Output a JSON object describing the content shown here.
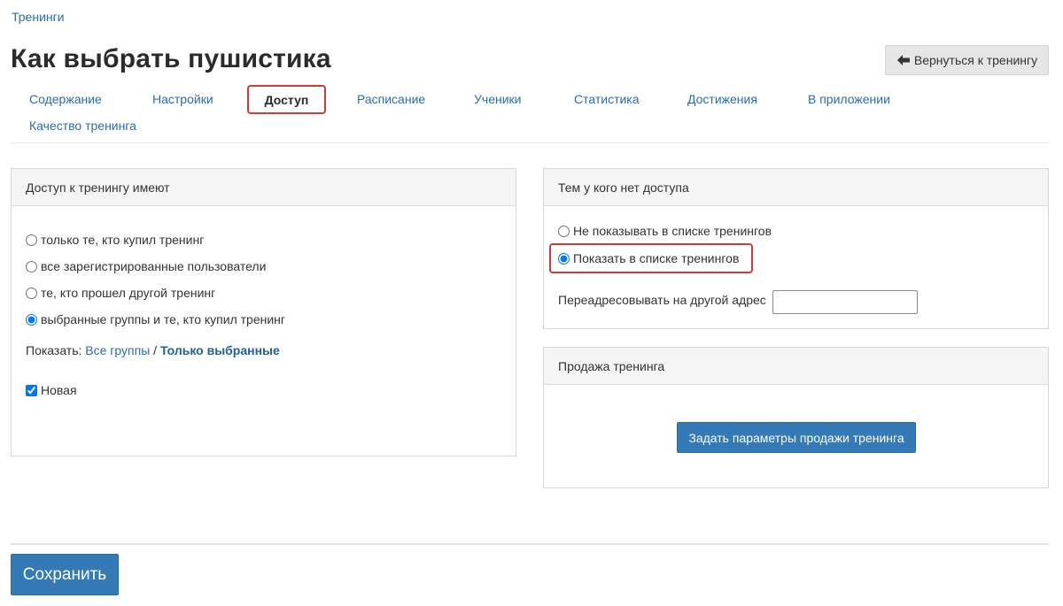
{
  "breadcrumb": {
    "label": "Тренинги"
  },
  "page": {
    "title": "Как выбрать пушистика"
  },
  "header": {
    "back_label": "Вернуться к тренингу"
  },
  "tabs": [
    {
      "label": "Содержание"
    },
    {
      "label": "Настройки"
    },
    {
      "label": "Доступ",
      "active": true
    },
    {
      "label": "Расписание"
    },
    {
      "label": "Ученики"
    },
    {
      "label": "Статистика"
    },
    {
      "label": "Достижения"
    },
    {
      "label": "В приложении"
    },
    {
      "label": "Качество тренинга"
    }
  ],
  "access_panel": {
    "title": "Доступ к тренингу имеют",
    "options": [
      {
        "label": "только те, кто купил тренинг",
        "checked": false
      },
      {
        "label": "все зарегистрированные пользователи",
        "checked": false
      },
      {
        "label": "те, кто прошел другой тренинг",
        "checked": false
      },
      {
        "label": "выбранные группы и те, кто купил тренинг",
        "checked": true
      }
    ],
    "show_prefix": "Показать:",
    "show_all_groups": "Все группы",
    "show_separator": "/",
    "show_only_selected": "Только выбранные",
    "groups": [
      {
        "label": "Новая",
        "checked": true
      }
    ]
  },
  "no_access_panel": {
    "title": "Тем у кого нет доступа",
    "options": [
      {
        "label": "Не показывать в списке тренингов",
        "checked": false
      },
      {
        "label": "Показать в списке тренингов",
        "checked": true
      }
    ],
    "redirect_label": "Переадресовывать на другой адрес",
    "redirect_value": ""
  },
  "sale_panel": {
    "title": "Продажа тренинга",
    "button_label": "Задать параметры продажи тренинга"
  },
  "footer": {
    "save_label": "Сохранить"
  },
  "colors": {
    "link": "#2a6db0",
    "primary_button": "#337ab7",
    "highlight": "#d23a3a"
  }
}
